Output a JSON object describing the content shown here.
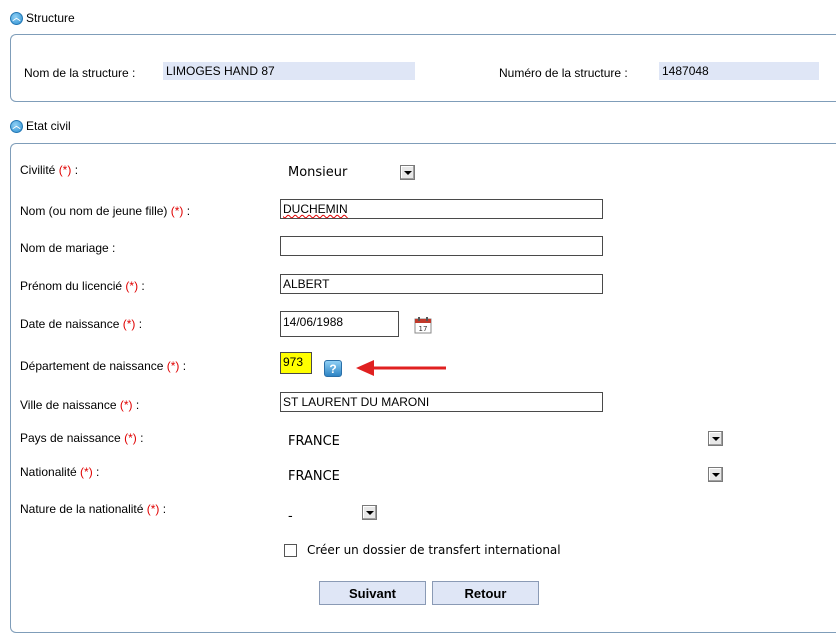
{
  "structure_section": {
    "title": "Structure",
    "name_label": "Nom de la structure :",
    "name_value": "LIMOGES HAND 87",
    "number_label": "Numéro de la structure :",
    "number_value": "1487048"
  },
  "etat_civil_section": {
    "title": "Etat civil",
    "required_mark": "(*)",
    "civilite": {
      "label": "Civilité",
      "value": "Monsieur"
    },
    "nom": {
      "label": "Nom (ou nom de jeune fille)",
      "value": "DUCHEMIN"
    },
    "nom_mariage": {
      "label": "Nom de mariage :",
      "value": ""
    },
    "prenom": {
      "label": "Prénom du licencié",
      "value": "ALBERT"
    },
    "date_naissance": {
      "label": "Date de naissance",
      "value": "14/06/1988",
      "calendar_day": "17"
    },
    "departement": {
      "label": "Département de naissance",
      "value": "973",
      "help_symbol": "?"
    },
    "ville": {
      "label": "Ville de naissance",
      "value": "ST LAURENT DU MARONI"
    },
    "pays": {
      "label": "Pays de naissance",
      "value": "FRANCE"
    },
    "nationalite": {
      "label": "Nationalité",
      "value": "FRANCE"
    },
    "nature_nationalite": {
      "label": "Nature de la nationalité",
      "value": "-"
    },
    "transfert_checkbox": {
      "label": "Créer un dossier de transfert international",
      "checked": false
    }
  },
  "buttons": {
    "next": "Suivant",
    "back": "Retour"
  },
  "colors": {
    "required": "#e00000",
    "highlight": "#ffff00",
    "arrow": "#e02020",
    "field_bg": "#dfe6f6"
  }
}
